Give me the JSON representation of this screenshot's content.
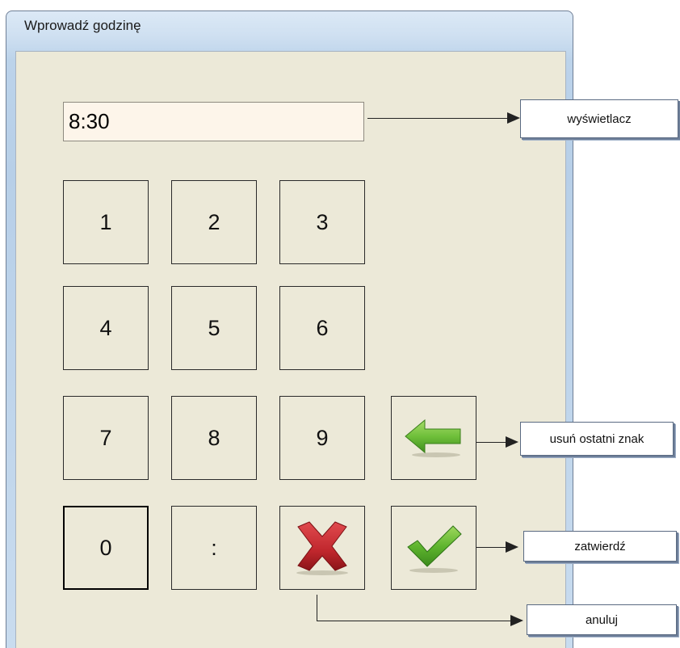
{
  "window": {
    "title": "Wprowadź godzinę"
  },
  "display": {
    "value": "8:30"
  },
  "keypad": {
    "k1": "1",
    "k2": "2",
    "k3": "3",
    "k4": "4",
    "k5": "5",
    "k6": "6",
    "k7": "7",
    "k8": "8",
    "k9": "9",
    "k0": "0",
    "colon": ":"
  },
  "icons": {
    "backspace": "green-left-arrow-icon",
    "cancel": "red-x-icon",
    "confirm": "green-checkmark-icon"
  },
  "annotations": {
    "display": "wyświetlacz",
    "backspace": "usuń ostatni znak",
    "confirm": "zatwierdź",
    "cancel": "anuluj"
  },
  "colors": {
    "client_bg": "#ece9d8",
    "display_bg": "#fdf5ea",
    "arrow_green": "#6fbf3a",
    "x_red": "#c0272d",
    "check_green": "#5fb52e"
  }
}
